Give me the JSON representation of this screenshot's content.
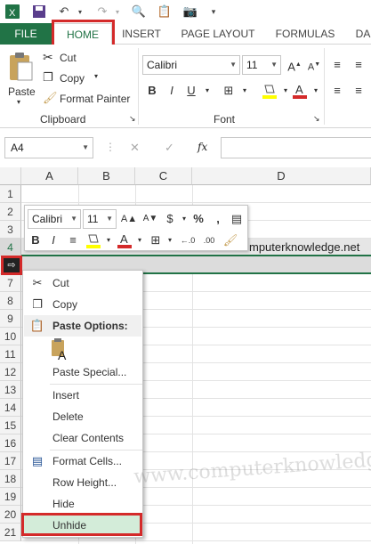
{
  "ribbon_tabs": [
    "FILE",
    "HOME",
    "INSERT",
    "PAGE LAYOUT",
    "FORMULAS",
    "DA"
  ],
  "quick_access": {
    "icons": [
      "excel-logo",
      "save",
      "undo",
      "redo",
      "print-preview",
      "paste-special",
      "camera"
    ]
  },
  "clipboard": {
    "paste_label": "Paste",
    "cut_label": "Cut",
    "copy_label": "Copy",
    "format_painter_label": "Format Painter",
    "group_label": "Clipboard"
  },
  "font": {
    "family": "Calibri",
    "size": "11",
    "bold": "B",
    "italic": "I",
    "underline": "U",
    "group_label": "Font"
  },
  "formula_bar": {
    "name_box": "A4",
    "fx": "fx",
    "value": ""
  },
  "columns": [
    "A",
    "B",
    "C",
    "D"
  ],
  "rows": [
    "1",
    "2",
    "3",
    "4",
    "",
    "7",
    "8",
    "9",
    "10",
    "11",
    "12",
    "13",
    "14",
    "15",
    "16",
    "17",
    "18",
    "19",
    "20",
    "21"
  ],
  "cell_text": "mputerknowledge.net",
  "mini_toolbar": {
    "font": "Calibri",
    "size": "11",
    "buttons_row1": [
      "A▲",
      "A▼",
      "$",
      "%",
      ","
    ],
    "buttons_row2": [
      "B",
      "I"
    ]
  },
  "context_menu": {
    "items": [
      {
        "label": "Cut",
        "icon": "scissors-icon"
      },
      {
        "label": "Copy",
        "icon": "copy-icon"
      },
      {
        "label": "Paste Options:",
        "icon": "paste-icon"
      },
      {
        "label": "",
        "icon": "paste-values-icon"
      },
      {
        "label": "Paste Special...",
        "icon": ""
      },
      {
        "label": "Insert",
        "icon": ""
      },
      {
        "label": "Delete",
        "icon": ""
      },
      {
        "label": "Clear Contents",
        "icon": ""
      },
      {
        "label": "Format Cells...",
        "icon": "format-cells-icon"
      },
      {
        "label": "Row Height...",
        "icon": ""
      },
      {
        "label": "Hide",
        "icon": ""
      },
      {
        "label": "Unhide",
        "icon": ""
      }
    ]
  },
  "watermark": "www.computerknowledge.net",
  "colors": {
    "excel_green": "#217346",
    "highlight_red": "#d42a2a",
    "hover_green": "#d3ecd9"
  }
}
